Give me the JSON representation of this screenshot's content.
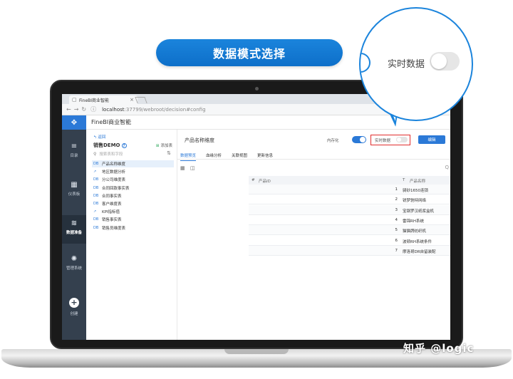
{
  "title_banner": "数据模式选择",
  "browser": {
    "tab_title": "FineBI商业智能",
    "tab_close": "×",
    "url_host": "localhost",
    "url_path": ":37799/webroot/decision#config"
  },
  "app": {
    "name": "FineBI商业智能"
  },
  "rail": [
    {
      "label": "目录",
      "icon": "≡"
    },
    {
      "label": "仪表板",
      "icon": "▦"
    },
    {
      "label": "数据准备",
      "icon": "≋"
    },
    {
      "label": "管理系统",
      "icon": "✺"
    },
    {
      "label": "创建",
      "icon": "+"
    }
  ],
  "tree": {
    "back": "返回",
    "package_title": "销售DEMO",
    "add_table": "添加表",
    "search_placeholder": "搜索表和字段",
    "items": [
      {
        "label": "产品名称维度",
        "selected": true,
        "icon": "DB"
      },
      {
        "label": "地区数据分析",
        "selected": false,
        "icon": "↗"
      },
      {
        "label": "分公司维度表",
        "selected": false,
        "icon": "DB"
      },
      {
        "label": "合同回款事实表",
        "selected": false,
        "icon": "DB"
      },
      {
        "label": "合同事实表",
        "selected": false,
        "icon": "DB"
      },
      {
        "label": "客户维度表",
        "selected": false,
        "icon": "DB"
      },
      {
        "label": "KPI指标值",
        "selected": false,
        "icon": "↗"
      },
      {
        "label": "销售事实表",
        "selected": false,
        "icon": "DB"
      },
      {
        "label": "销售员维度表",
        "selected": false,
        "icon": "DB"
      }
    ]
  },
  "content": {
    "title": "产品名称维度",
    "in_memory_label": "内存化",
    "realtime_label": "实时数据",
    "edit_button": "编辑",
    "subtabs": [
      "数据预览",
      "血缘分析",
      "关联视图",
      "更新信息"
    ],
    "search_icon": "Q",
    "table": {
      "headers": [
        "产品ID",
        "产品名称"
      ],
      "header_prefix_1": "#",
      "header_prefix_2": "T",
      "rows": [
        {
          "id": "1",
          "name": "骑砂1650连锁"
        },
        {
          "id": "2",
          "name": "锐梦驰特网络"
        },
        {
          "id": "3",
          "name": "宝钢罗汉纸浆盒机"
        },
        {
          "id": "4",
          "name": "雷锦RH系统"
        },
        {
          "id": "5",
          "name": "猫猫牌纺织机"
        },
        {
          "id": "6",
          "name": "波顿RH系统条件"
        },
        {
          "id": "7",
          "name": "摩洛哥DR自留装配"
        }
      ]
    }
  },
  "magnifier": {
    "realtime_label": "实时数据"
  },
  "watermark": "知乎 @logic",
  "colors": {
    "accent": "#2b79d7",
    "rail_bg": "#34404e",
    "highlight_box": "#e02d2d"
  }
}
